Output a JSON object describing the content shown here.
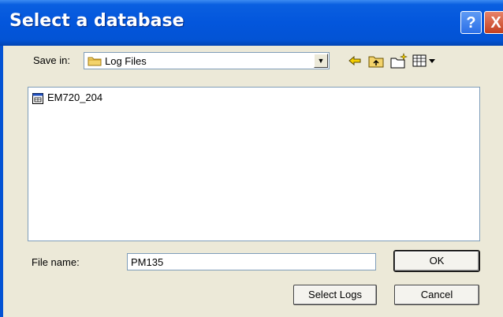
{
  "window": {
    "title": "Select a database"
  },
  "title_buttons": {
    "help": "?",
    "close": "X"
  },
  "location": {
    "label": "Save in:",
    "folder": "Log Files"
  },
  "toolbar": {
    "icons": [
      "back-arrow-icon",
      "up-folder-icon",
      "new-folder-icon",
      "view-menu-icon"
    ]
  },
  "files": [
    {
      "name": "EM720_204",
      "icon": "database-file-icon"
    }
  ],
  "filename": {
    "label": "File name:",
    "value": "PM135"
  },
  "buttons": {
    "ok": "OK",
    "select_logs": "Select Logs",
    "cancel": "Cancel"
  },
  "colors": {
    "titlebar": "#0356dc",
    "dialog_bg": "#ece9d8",
    "field_border": "#7f9db9"
  }
}
